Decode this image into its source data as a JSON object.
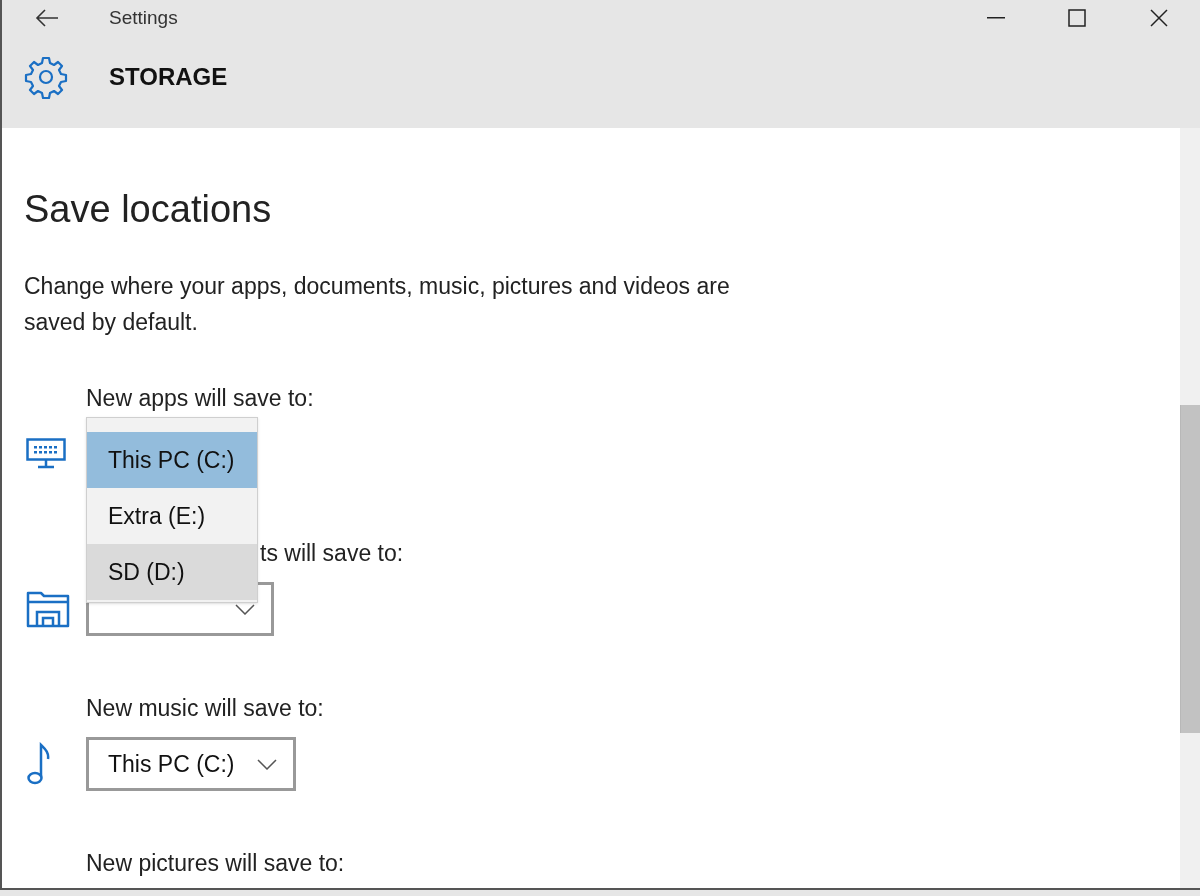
{
  "window": {
    "title": "Settings"
  },
  "header": {
    "title": "STORAGE"
  },
  "section": {
    "heading": "Save locations",
    "description": "Change where your apps, documents, music, pictures and videos are saved by default."
  },
  "locations": [
    {
      "kind": "apps",
      "label": "New apps will save to:",
      "dropdown": {
        "open": true,
        "options": [
          {
            "label": "This PC (C:)",
            "selected": true,
            "highlighted": false
          },
          {
            "label": "Extra (E:)",
            "selected": false,
            "highlighted": false
          },
          {
            "label": "SD (D:)",
            "selected": false,
            "highlighted": true
          }
        ]
      }
    },
    {
      "kind": "documents",
      "label": "ts will save to:",
      "dropdown": {
        "open": false
      }
    },
    {
      "kind": "music",
      "label": "New music will save to:",
      "dropdown": {
        "open": false,
        "value": "This PC (C:)"
      }
    },
    {
      "label": "New pictures will save to:"
    }
  ]
}
